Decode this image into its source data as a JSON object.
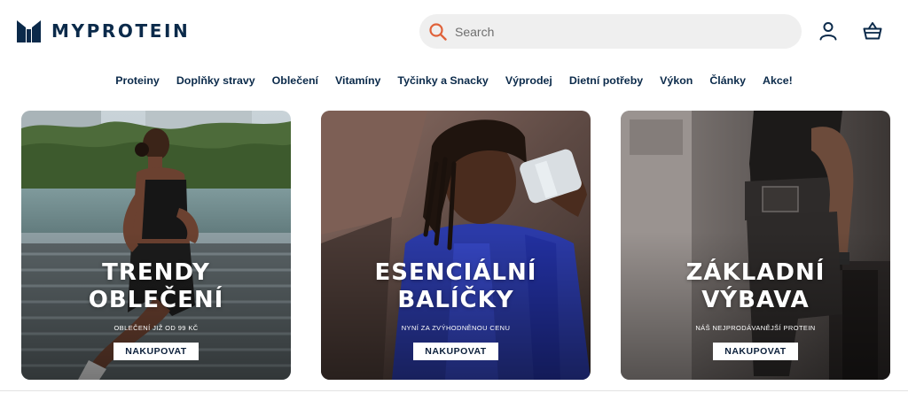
{
  "header": {
    "logo_text": "MYPROTEIN",
    "search": {
      "placeholder": "Search"
    },
    "icons": [
      "search-icon",
      "account-icon",
      "basket-icon"
    ]
  },
  "nav": {
    "items": [
      "Proteiny",
      "Doplňky stravy",
      "Oblečení",
      "Vitamíny",
      "Tyčinky a Snacky",
      "Výprodej",
      "Dietní potřeby",
      "Výkon",
      "Články",
      "Akce!"
    ]
  },
  "promos": [
    {
      "title_line1": "TRENDY",
      "title_line2": "OBLEČENÍ",
      "subtitle": "OBLEČENÍ JIŽ OD 99 KČ",
      "button": "NAKUPOVAT"
    },
    {
      "title_line1": "ESENCIÁLNÍ",
      "title_line2": "BALÍČKY",
      "subtitle": "NYNÍ ZA ZVÝHODNĚNOU CENU",
      "button": "NAKUPOVAT"
    },
    {
      "title_line1": "ZÁKLADNÍ",
      "title_line2": "VÝBAVA",
      "subtitle": "NÁŠ NEJPRODÁVANĚJŠÍ PROTEIN",
      "button": "NAKUPOVAT"
    }
  ],
  "colors": {
    "brand_navy": "#0b2a4a",
    "search_accent": "#e0623a",
    "search_bg": "#efefef"
  }
}
